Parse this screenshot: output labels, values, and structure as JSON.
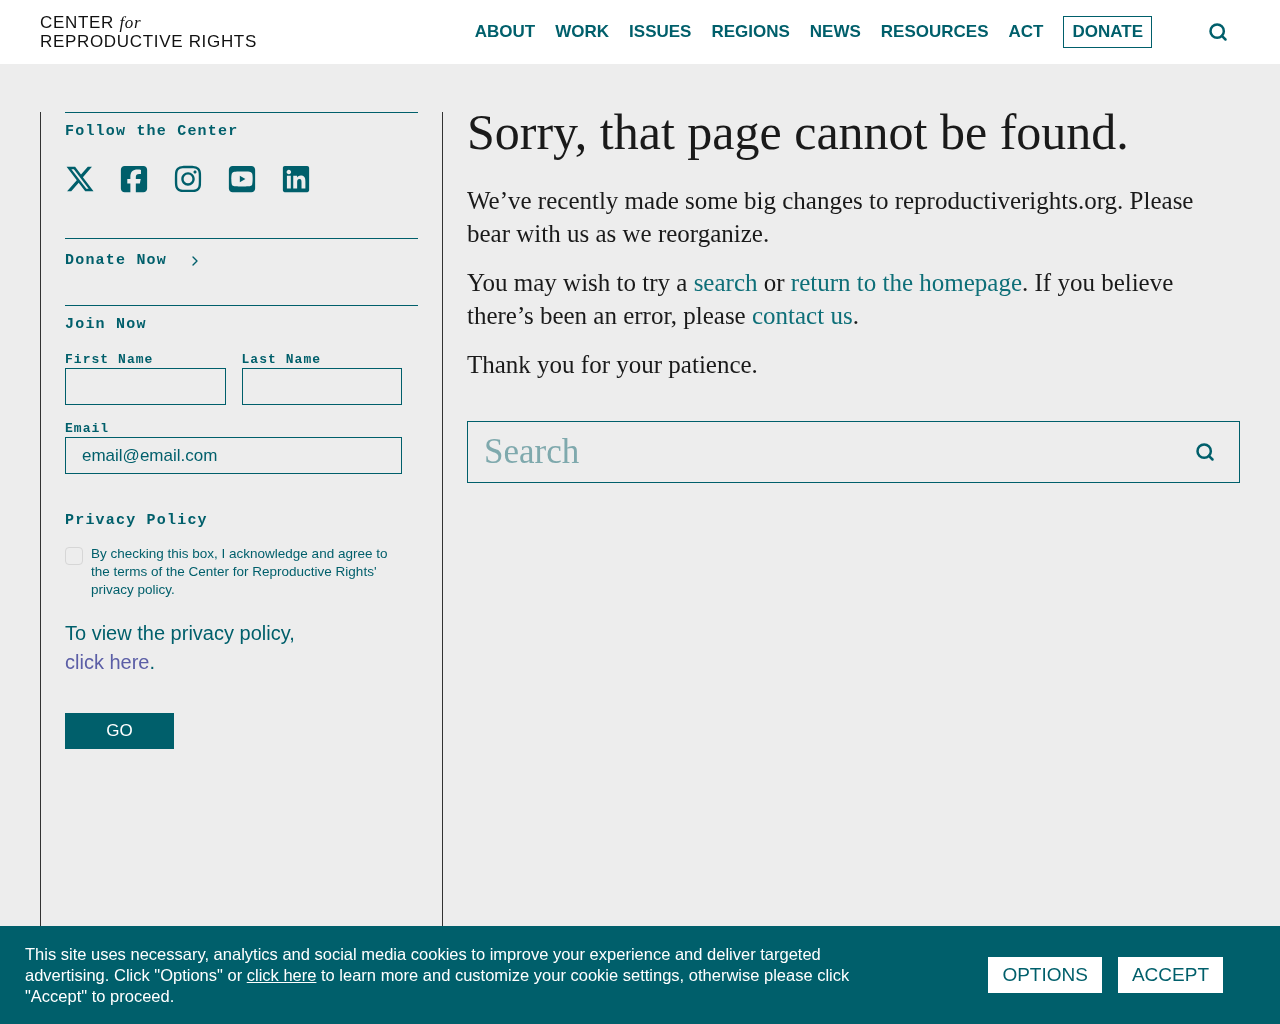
{
  "header": {
    "logo": {
      "line1": "CENTER",
      "for": "for",
      "line2": "REPRODUCTIVE RIGHTS"
    },
    "nav": [
      {
        "label": "ABOUT",
        "kind": "link"
      },
      {
        "label": "WORK",
        "kind": "link"
      },
      {
        "label": "ISSUES",
        "kind": "link"
      },
      {
        "label": "REGIONS",
        "kind": "link"
      },
      {
        "label": "NEWS",
        "kind": "link"
      },
      {
        "label": "RESOURCES",
        "kind": "link"
      },
      {
        "label": "ACT",
        "kind": "link"
      },
      {
        "label": "DONATE",
        "kind": "button"
      }
    ]
  },
  "sidebar": {
    "follow_title": "Follow the Center",
    "donate_link": "Donate Now",
    "join_title": "Join Now",
    "first_name": {
      "label": "First Name"
    },
    "last_name": {
      "label": "Last Name"
    },
    "email": {
      "label": "Email",
      "value": "email@email.com"
    },
    "privacy_title": "Privacy Policy",
    "privacy_checkbox": {
      "label": "By checking this box, I acknowledge and agree to the terms of the Center for Reproductive Rights' privacy policy.",
      "checked": false
    },
    "privacy_note": [
      {
        "text": "To view the privacy policy, ",
        "kind": "text"
      },
      {
        "text": "click here",
        "kind": "link"
      },
      {
        "text": ".",
        "kind": "text"
      }
    ],
    "submit": "GO"
  },
  "main": {
    "title": "Sorry, that page cannot be found.",
    "paragraphs": [
      [
        {
          "text": "We’ve recently made some big changes to reproductiverights.org. Please bear with us as we reorganize.",
          "kind": "text"
        }
      ],
      [
        {
          "text": "You may wish to try a ",
          "kind": "text"
        },
        {
          "text": "search",
          "kind": "link"
        },
        {
          "text": " or ",
          "kind": "text"
        },
        {
          "text": "return to the homepage",
          "kind": "link"
        },
        {
          "text": ". If you believe there’s been an error, please ",
          "kind": "text"
        },
        {
          "text": "contact us",
          "kind": "link"
        },
        {
          "text": ".",
          "kind": "text"
        }
      ],
      [
        {
          "text": "Thank you for your patience.",
          "kind": "text"
        }
      ]
    ],
    "search": {
      "placeholder": "Search"
    }
  },
  "cookie_bar": {
    "text": [
      {
        "text": "This site uses necessary, analytics and social media cookies to improve your experience and deliver targeted advertising. Click \"Options\" or ",
        "kind": "text"
      },
      {
        "text": "click here",
        "kind": "link"
      },
      {
        "text": " to learn more and customize your cookie settings, otherwise please click \"Accept\" to proceed.",
        "kind": "text"
      }
    ],
    "buttons": [
      "OPTIONS",
      "ACCEPT"
    ]
  }
}
